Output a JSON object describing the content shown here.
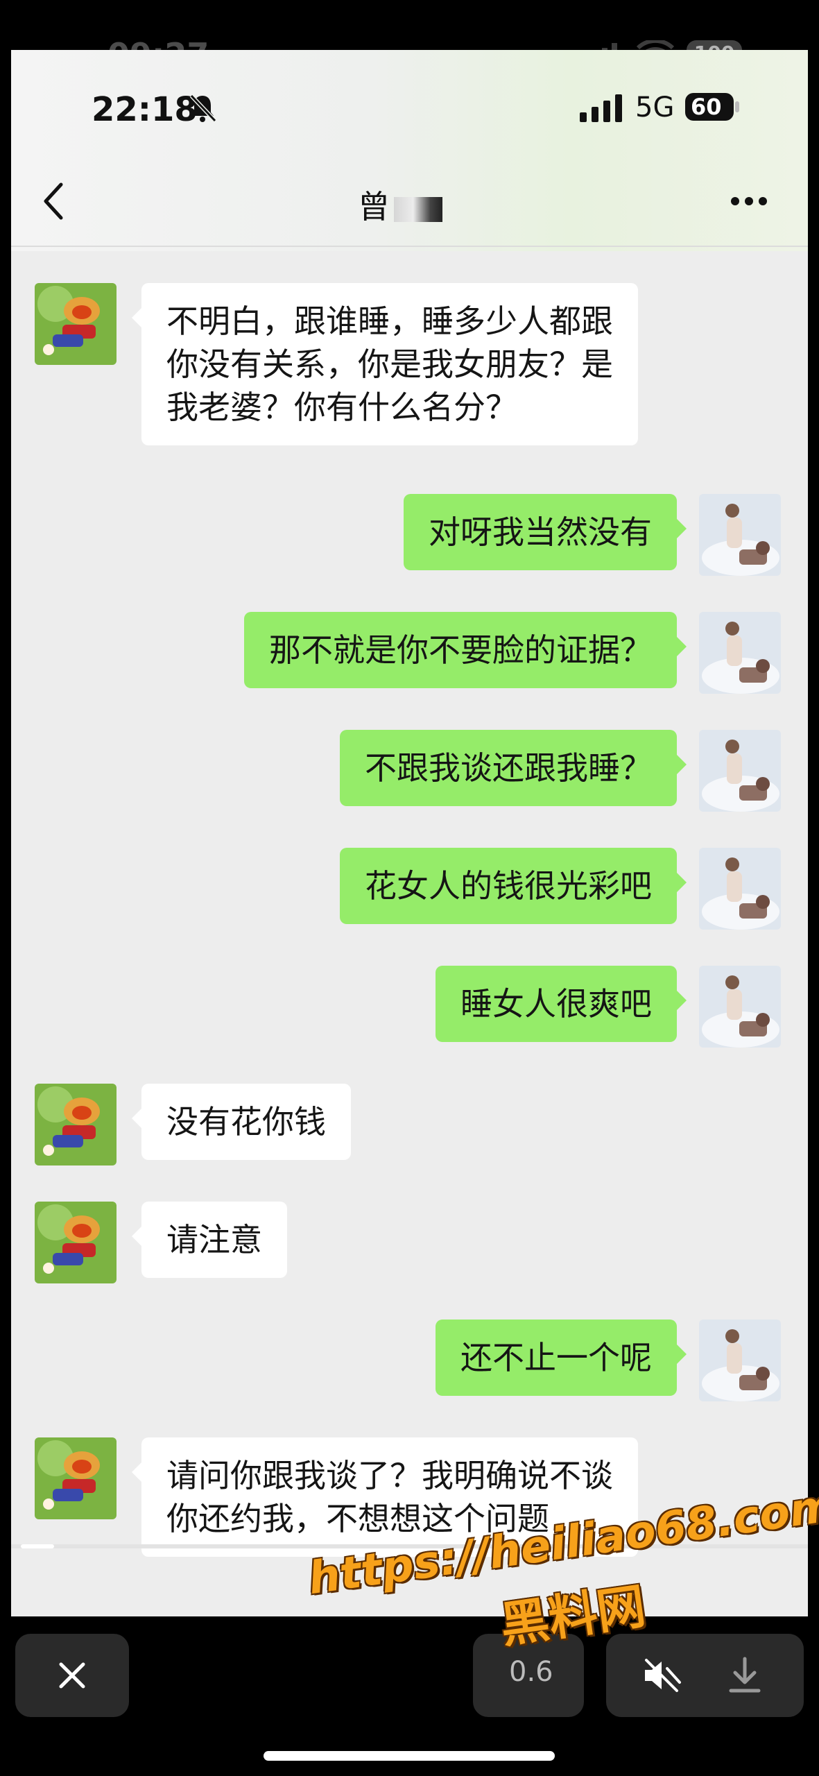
{
  "outer_status": {
    "time": "09:27",
    "battery": "100"
  },
  "status_bar": {
    "time": "22:18",
    "network": "5G",
    "battery": "60"
  },
  "chat": {
    "title": "曾"
  },
  "messages": [
    {
      "side": "left",
      "text": "不明白，跟谁睡，睡多少人都跟\n你没有关系，你是我女朋友？是\n我老婆？你有什么名分？"
    },
    {
      "side": "right",
      "text": "对呀我当然没有"
    },
    {
      "side": "right",
      "text": "那不就是你不要脸的证据？"
    },
    {
      "side": "right",
      "text": "不跟我谈还跟我睡？"
    },
    {
      "side": "right",
      "text": "花女人的钱很光彩吧"
    },
    {
      "side": "right",
      "text": "睡女人很爽吧"
    },
    {
      "side": "left",
      "text": "没有花你钱"
    },
    {
      "side": "left",
      "text": "请注意"
    },
    {
      "side": "right",
      "text": "还不止一个呢"
    },
    {
      "side": "left",
      "text": "请问你跟我谈了？我明确说不谈\n你还约我，不想想这个问题"
    }
  ],
  "player": {
    "mid_label": "0.6"
  },
  "watermark": {
    "url": "https://heiliao68.com",
    "name": "黑料网"
  },
  "colors": {
    "self_bubble": "#95ec69",
    "other_bubble": "#ffffff",
    "chat_bg": "#ededed",
    "watermark": "#f7a11a"
  }
}
